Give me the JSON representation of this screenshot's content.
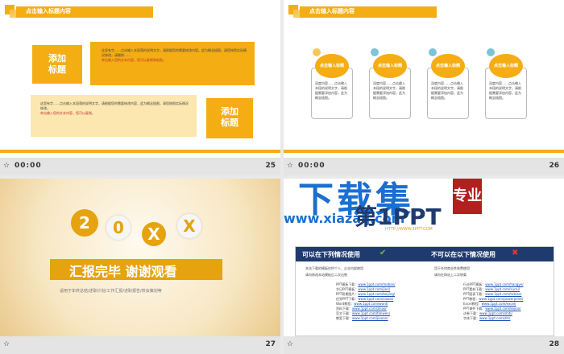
{
  "slides": [
    {
      "header": "点击输入标题内容",
      "box_left": "添加\n标题",
      "box_right": "添加\n标题",
      "para_top": "这里有字……点击输入本段落的说明文字，请根据您的需要修改内容。此为概念插图，请您按照实际情况修改，请删除……",
      "para_top_red": "单击输入您的文本内容，您可以复制和粘贴。",
      "para_bottom": "这里有字……点击输入本段落的说明文字，请根据您的需要修改内容，此为概念插图，请您按照实际情况修改。",
      "para_bottom_red": "单击输入您的文本内容，您可以复制。",
      "timer": "00:00",
      "num": "25"
    },
    {
      "header": "点击输入标题内容",
      "cards": [
        {
          "title": "点击输入标题",
          "text": "深度内容……点击输入本段的说明文字，请根据需要添加内容，此为概念插图。"
        },
        {
          "title": "点击输入标题",
          "text": "深度内容……点击输入本段的说明文字，请根据需要添加内容，此为概念插图。"
        },
        {
          "title": "点击输入标题",
          "text": "深度内容……点击输入本段的说明文字，请根据需要添加内容，此为概念插图。"
        },
        {
          "title": "点击输入标题",
          "text": "深度内容……点击输入本段的说明文字，请根据需要添加内容，此为概念插图。"
        }
      ],
      "timer": "00:00",
      "num": "26"
    },
    {
      "circles": [
        "2",
        "0",
        "X",
        "X"
      ],
      "title": "汇报完毕 谢谢观看",
      "subtitle": "适用于年终总结/述职计划/工作汇报/述职报告/校会策划等",
      "num": "27"
    },
    {
      "watermark_big": "下载集",
      "watermark_seal": "专业",
      "watermark_url": "www.xiazaij.com",
      "watermark_small": "第1PPT",
      "site_url": "HTTP://WWW.1PPT.COM",
      "can_use": "可以在下列情况使用",
      "cannot_use": "不可以在以下情况使用",
      "left_points": [
        "本站下载的模板仅供个人、企业内部使用",
        "请勿修改本站模板后二次出售"
      ],
      "right_points": [
        "用于任何商业性收费使用",
        "请勿在网站上二次转载"
      ],
      "left_list": [
        [
          "PPT模板下载",
          "www.1ppt.com/moban/"
        ],
        [
          "节日PPT模板",
          "www.1ppt.com/jieri/"
        ],
        [
          "PPT背景图片",
          "www.1ppt.com/beijing/"
        ],
        [
          "优秀PPT下载",
          "www.1ppt.com/xiazai/"
        ],
        [
          "Word教程",
          "www.1ppt.com/word/"
        ],
        [
          "资料下载",
          "www.1ppt.com/ziliao/"
        ],
        [
          "范文下载",
          "www.1ppt.com/fanwen/"
        ],
        [
          "教案下载",
          "www.1ppt.com/jiaoan/"
        ]
      ],
      "right_list": [
        [
          "行业PPT模板",
          "www.1ppt.com/hangye/"
        ],
        [
          "PPT素材下载",
          "www.1ppt.com/sucai/"
        ],
        [
          "PPT图表下载",
          "www.1ppt.com/tubiao/"
        ],
        [
          "PPT教程",
          "www.1ppt.com/powerpoint/"
        ],
        [
          "Excel教程",
          "www.1ppt.com/excel/"
        ],
        [
          "PPT课件下载",
          "www.1ppt.com/kejian/"
        ],
        [
          "试卷下载",
          "www.1ppt.com/shiti/"
        ],
        [
          "字体下载",
          "www.1ppt.com/ziti/"
        ]
      ],
      "num": "28"
    }
  ],
  "colors": {
    "accent": "#f4ad13",
    "navy": "#1f3a6e"
  }
}
